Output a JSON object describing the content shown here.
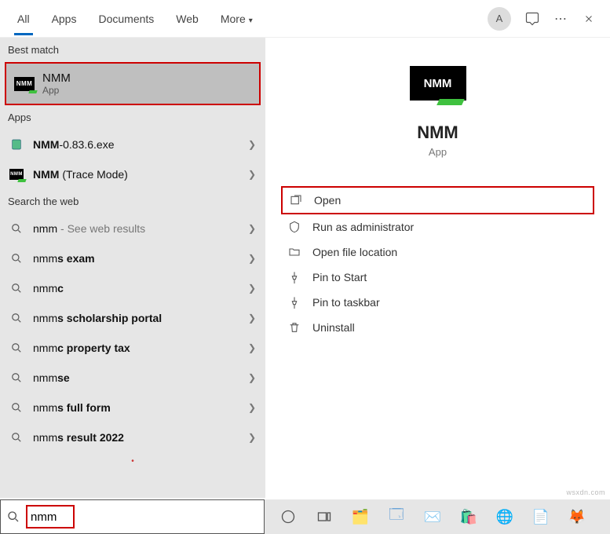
{
  "tabs": {
    "all": "All",
    "apps": "Apps",
    "documents": "Documents",
    "web": "Web",
    "more": "More"
  },
  "avatar": "A",
  "sections": {
    "best_match": "Best match",
    "apps": "Apps",
    "search_web": "Search the web"
  },
  "best_match": {
    "title": "NMM",
    "subtitle": "App"
  },
  "app_rows": [
    {
      "bold": "NMM",
      "rest": "-0.83.6.exe"
    },
    {
      "bold": "NMM",
      "rest": " (Trace Mode)"
    }
  ],
  "web_rows": [
    {
      "bold": "nmm",
      "rest": " - See web results",
      "dim": true
    },
    {
      "bold": "nmm",
      "rest2": "s exam"
    },
    {
      "bold": "nmm",
      "rest2": "c"
    },
    {
      "bold": "nmm",
      "rest2": "s scholarship portal"
    },
    {
      "bold": "nmm",
      "rest2": "c property tax"
    },
    {
      "bold": "nmm",
      "rest2": "se"
    },
    {
      "bold": "nmm",
      "rest2": "s full form"
    },
    {
      "bold": "nmm",
      "rest2": "s result 2022"
    }
  ],
  "detail": {
    "logo": "NMM",
    "title": "NMM",
    "subtitle": "App"
  },
  "actions": {
    "open": "Open",
    "admin": "Run as administrator",
    "location": "Open file location",
    "pin_start": "Pin to Start",
    "pin_taskbar": "Pin to taskbar",
    "uninstall": "Uninstall"
  },
  "search": {
    "value": "nmm"
  },
  "watermark": "wsxdn.com"
}
